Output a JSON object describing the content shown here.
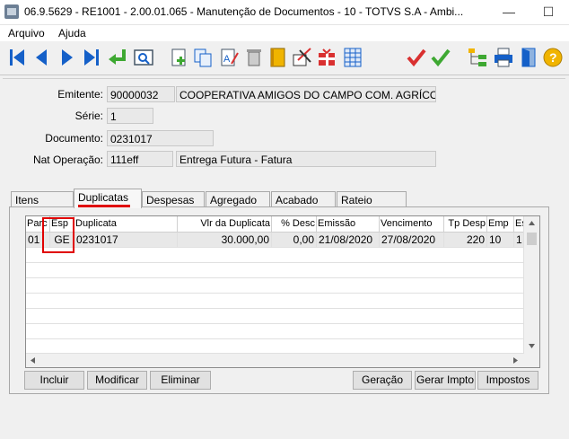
{
  "window": {
    "title": "06.9.5629 - RE1001 - 2.00.01.065 - Manutenção de Documentos - 10 - TOTVS S.A - Ambi...",
    "minimize": "—",
    "maximize": "☐"
  },
  "menu": [
    "Arquivo",
    "Ajuda"
  ],
  "toolbar": {
    "icons": [
      "first-icon",
      "prev-icon",
      "next-icon",
      "last-icon",
      "return-icon",
      "zoom-icon",
      "new-icon",
      "copy-icon",
      "edit-icon",
      "delete-icon",
      "book-icon",
      "cut-icon",
      "gift-icon",
      "grid-icon",
      "cancel-check-icon",
      "ok-check-icon",
      "tree-icon",
      "print-icon",
      "exit-icon",
      "help-icon"
    ],
    "colors": {
      "nav": "#1560c8",
      "green": "#3ea832",
      "red": "#d93030",
      "yellow": "#f0b400"
    }
  },
  "form": {
    "emitente_label": "Emitente:",
    "emitente_code": "90000032",
    "emitente_name": "COOPERATIVA AMIGOS DO CAMPO COM. AGRÍCOL",
    "serie_label": "Série:",
    "serie": "1",
    "documento_label": "Documento:",
    "documento": "0231017",
    "natop_label": "Nat Operação:",
    "natop_code": "111eff",
    "natop_desc": "Entrega Futura - Fatura"
  },
  "tabs": [
    "Itens",
    "Duplicatas",
    "Despesas",
    "Agregado",
    "Acabado",
    "Rateio"
  ],
  "active_tab": "Duplicatas",
  "grid": {
    "columns": [
      "Parc",
      "Esp",
      "Duplicata",
      "Vlr da Duplicata",
      "% Desc",
      "Emissão",
      "Vencimento",
      "Tp Desp",
      "Emp",
      "Es"
    ],
    "rows": [
      [
        "01",
        "GE",
        "0231017",
        "30.000,00",
        "0,00",
        "21/08/2020",
        "27/08/2020",
        "220",
        "10",
        "1"
      ]
    ]
  },
  "buttons": {
    "incluir": "Incluir",
    "modificar": "Modificar",
    "eliminar": "Eliminar",
    "geracao": "Geração",
    "gerar_impto": "Gerar Impto",
    "impostos": "Impostos"
  },
  "annotation_color": "#e00000"
}
